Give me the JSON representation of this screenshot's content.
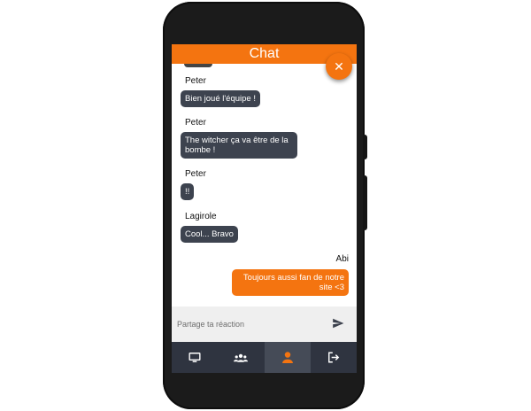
{
  "app": {
    "title": "Chat"
  },
  "header": {
    "title": "Chat",
    "close_icon": "close-icon",
    "close_glyph": "✕",
    "accent": "#f47410"
  },
  "messages": [
    {
      "sender": "Peter",
      "text": "Bien joué l'équipe !",
      "mine": false
    },
    {
      "sender": "Peter",
      "text": "The witcher ça va être de la bombe !",
      "mine": false
    },
    {
      "sender": "Peter",
      "text": "!!",
      "mine": false
    },
    {
      "sender": "Lagirole",
      "text": "Cool... Bravo",
      "mine": false
    },
    {
      "sender": "Abi",
      "text": "Toujours aussi fan de notre site <3",
      "mine": true
    }
  ],
  "composer": {
    "placeholder": "Partage ta réaction",
    "send_icon": "send-icon"
  },
  "nav": {
    "items": [
      {
        "icon": "monitor-icon",
        "active": false
      },
      {
        "icon": "users-icon",
        "active": false
      },
      {
        "icon": "user-icon",
        "active": true
      },
      {
        "icon": "logout-icon",
        "active": false
      }
    ],
    "active_color": "#f47410",
    "icon_color": "#ffffff"
  },
  "colors": {
    "bubble_other": "#3d434f",
    "bubble_mine": "#f47410",
    "nav_bg": "#2f3440"
  }
}
